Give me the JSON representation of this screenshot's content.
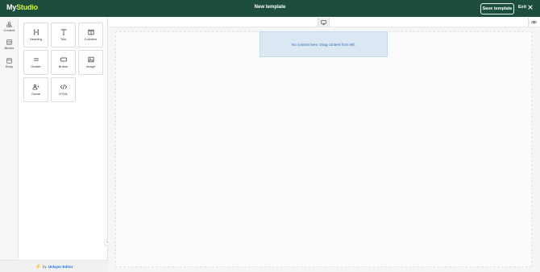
{
  "header": {
    "brand_prefix": "My",
    "brand_suffix": "Studio",
    "title": "New template",
    "save_label": "Save template",
    "exit_label": "Exit"
  },
  "rail": {
    "items": [
      {
        "label": "Content",
        "icon": "shapes-icon"
      },
      {
        "label": "Blocks",
        "icon": "blocks-icon"
      },
      {
        "label": "Body",
        "icon": "body-icon"
      }
    ]
  },
  "tools": {
    "items": [
      {
        "label": "Heading",
        "icon": "heading-icon"
      },
      {
        "label": "Text",
        "icon": "text-icon"
      },
      {
        "label": "Columns",
        "icon": "columns-icon"
      },
      {
        "label": "Divider",
        "icon": "divider-icon"
      },
      {
        "label": "Button",
        "icon": "button-icon"
      },
      {
        "label": "Image",
        "icon": "image-icon"
      },
      {
        "label": "Social",
        "icon": "social-icon"
      },
      {
        "label": "HTML",
        "icon": "code-icon"
      }
    ]
  },
  "footer": {
    "by_text": "by",
    "link_text": "Unlayer Editor"
  },
  "canvas": {
    "empty_message": "No content here. Drag content from left."
  },
  "colors": {
    "header_bg": "#1d4d3b",
    "brand_accent": "#d2f34a",
    "dropzone_bg": "#dbe7f3",
    "dropzone_text": "#2f6db5"
  }
}
